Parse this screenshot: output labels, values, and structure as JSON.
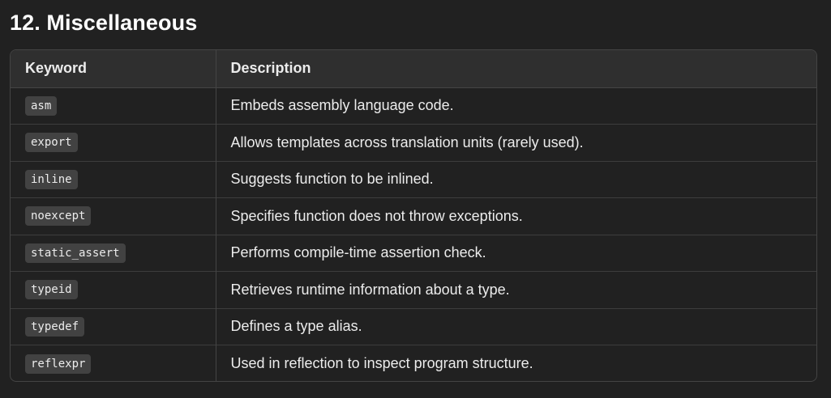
{
  "section": {
    "title": "12. Miscellaneous"
  },
  "table": {
    "headers": [
      "Keyword",
      "Description"
    ],
    "rows": [
      {
        "keyword": "asm",
        "description": "Embeds assembly language code."
      },
      {
        "keyword": "export",
        "description": "Allows templates across translation units (rarely used)."
      },
      {
        "keyword": "inline",
        "description": "Suggests function to be inlined."
      },
      {
        "keyword": "noexcept",
        "description": "Specifies function does not throw exceptions."
      },
      {
        "keyword": "static_assert",
        "description": "Performs compile-time assertion check."
      },
      {
        "keyword": "typeid",
        "description": "Retrieves runtime information about a type."
      },
      {
        "keyword": "typedef",
        "description": "Defines a type alias."
      },
      {
        "keyword": "reflexpr",
        "description": "Used in reflection to inspect program structure."
      }
    ]
  }
}
